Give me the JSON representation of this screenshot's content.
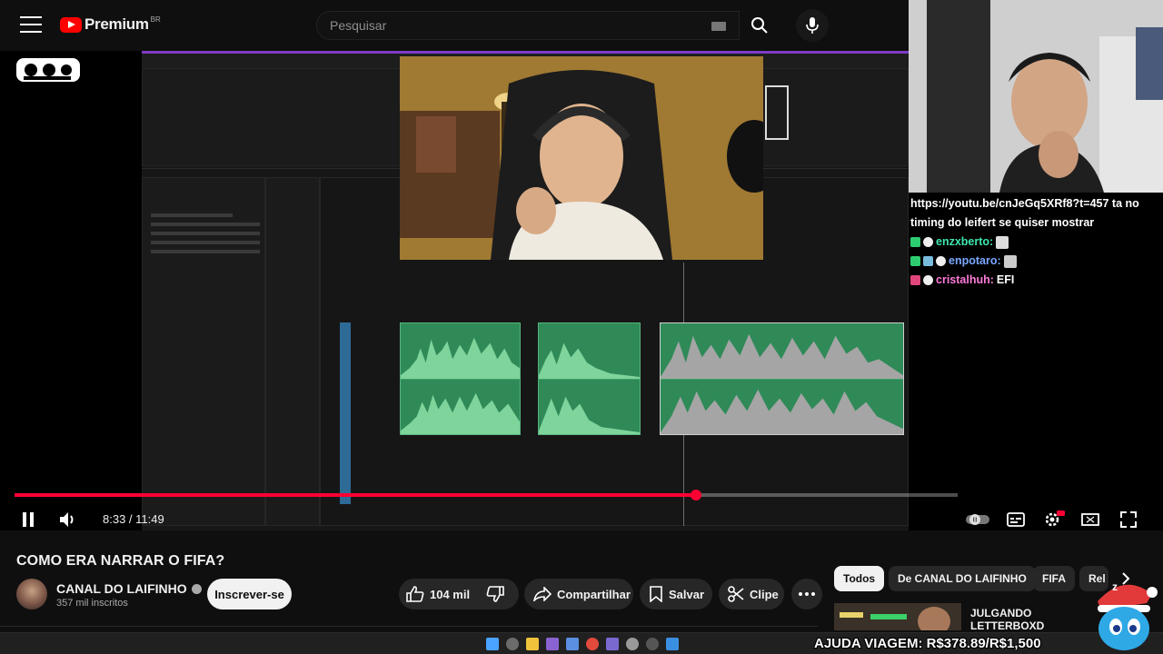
{
  "header": {
    "logo_text": "Premium",
    "logo_region": "BR",
    "search_placeholder": "Pesquisar"
  },
  "player": {
    "current_time": "8:33",
    "duration": "11:49",
    "time_display": "8:33 / 11:49",
    "progress_fraction": 0.723,
    "state": "playing"
  },
  "chat": {
    "messages": [
      {
        "user": "",
        "text": "https://youtu.be/cnJeGq5XRf8?t=457 ta no timing do leifert se quiser mostrar"
      },
      {
        "user": "enzxberto:",
        "text": ""
      },
      {
        "user": "enpotaro:",
        "text": ""
      },
      {
        "user": "cristalhuh:",
        "text": "EFI"
      }
    ]
  },
  "video": {
    "title": "COMO ERA NARRAR O FIFA?",
    "channel": "CANAL DO LAIFINHO",
    "subscribers": "357 mil inscritos",
    "subscribe_label": "Inscrever-se",
    "likes": "104 mil",
    "share_label": "Compartilhar",
    "save_label": "Salvar",
    "clip_label": "Clipe"
  },
  "chips": [
    "Todos",
    "De CANAL DO LAIFINHO",
    "FIFA",
    "Rel"
  ],
  "recommendation": {
    "title": "JULGANDO LETTERBOXD INSCRITOS"
  },
  "overlay": {
    "donation": "AJUDA VIAGEM: R$378.89/R$1,500"
  },
  "colors": {
    "accent_red": "#ff0033",
    "timeline_green": "#2f8a58",
    "bg": "#0f0f0f",
    "chip_active": "#f1f1f1"
  },
  "icons": [
    "menu-icon",
    "youtube-logo",
    "keyboard-icon",
    "search-icon",
    "mic-icon",
    "pause-icon",
    "volume-icon",
    "autoplay-toggle",
    "subtitles-icon",
    "settings-icon",
    "theater-icon",
    "fullscreen-icon",
    "like-icon",
    "dislike-icon",
    "share-icon",
    "save-icon",
    "clip-icon",
    "more-icon",
    "chevron-right-icon",
    "verified-icon"
  ]
}
